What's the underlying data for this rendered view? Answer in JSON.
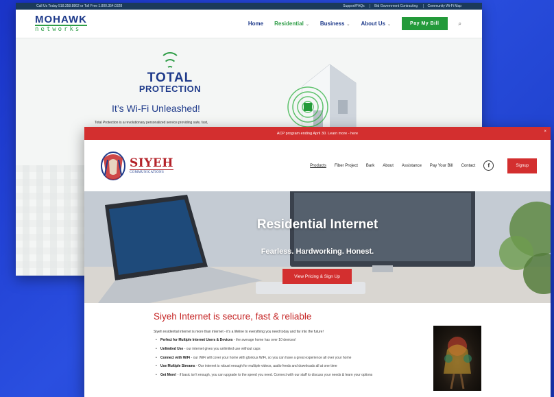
{
  "mohawk": {
    "topbar": {
      "call": "Call Us Today 518.358.8862 or Toll Free 1.800.354.0328",
      "links": [
        "Support/FAQs",
        "Bid Government Contracting",
        "Community Wi-Fi Map"
      ]
    },
    "logo_top": "MOHAWK",
    "logo_bottom": "networks",
    "nav": {
      "home": "Home",
      "residential": "Residential",
      "business": "Business",
      "about": "About Us",
      "pay": "Pay My Bill"
    },
    "hero": {
      "logo_line1": "TOTAL",
      "logo_line2": "PROTECTION",
      "slogan": "It’s Wi-Fi Unleashed!",
      "desc": "Total Protection is a revolutionary personalized service providing safe, fast,"
    }
  },
  "siyeh": {
    "alert": "ACP program ending April 30. Learn more - here",
    "logo_word": "SIYEH",
    "logo_sub": "COMMUNICATIONS",
    "nav": [
      "Products",
      "Fiber Project",
      "Bark",
      "About",
      "Assistance",
      "Pay Your Bill",
      "Contact"
    ],
    "facebook": "f",
    "signup": "Signup",
    "hero": {
      "title": "Residential Internet",
      "tagline": "Fearless. Hardworking. Honest.",
      "cta": "View Pricing & Sign Up"
    },
    "section_title": "Siyeh Internet is secure, fast & reliable",
    "intro": "Siyeh residential internet is more than internet - it’s a lifeline to everything you need today and far into the future!",
    "features": [
      {
        "title": "Perfect for Multiple Internet Users & Devices",
        "text": " - the average home has over 10 devices!"
      },
      {
        "title": "Unlimited Use",
        "text": " - our internet gives you unlimited use without caps"
      },
      {
        "title": "Connect with WiFi",
        "text": " - our WiFi will cover your home with glorious WiFi, so you can have a great experience all over your home"
      },
      {
        "title": "Use Multiple Streams",
        "text": " - Our internet is robust enough for multiple videos, audio feeds and downloads all at one time"
      },
      {
        "title": "Get More!",
        "text": " - if basic isn’t enough, you can upgrade to the speed you need. Connect with our staff to discuss your needs & learn your options"
      }
    ]
  }
}
